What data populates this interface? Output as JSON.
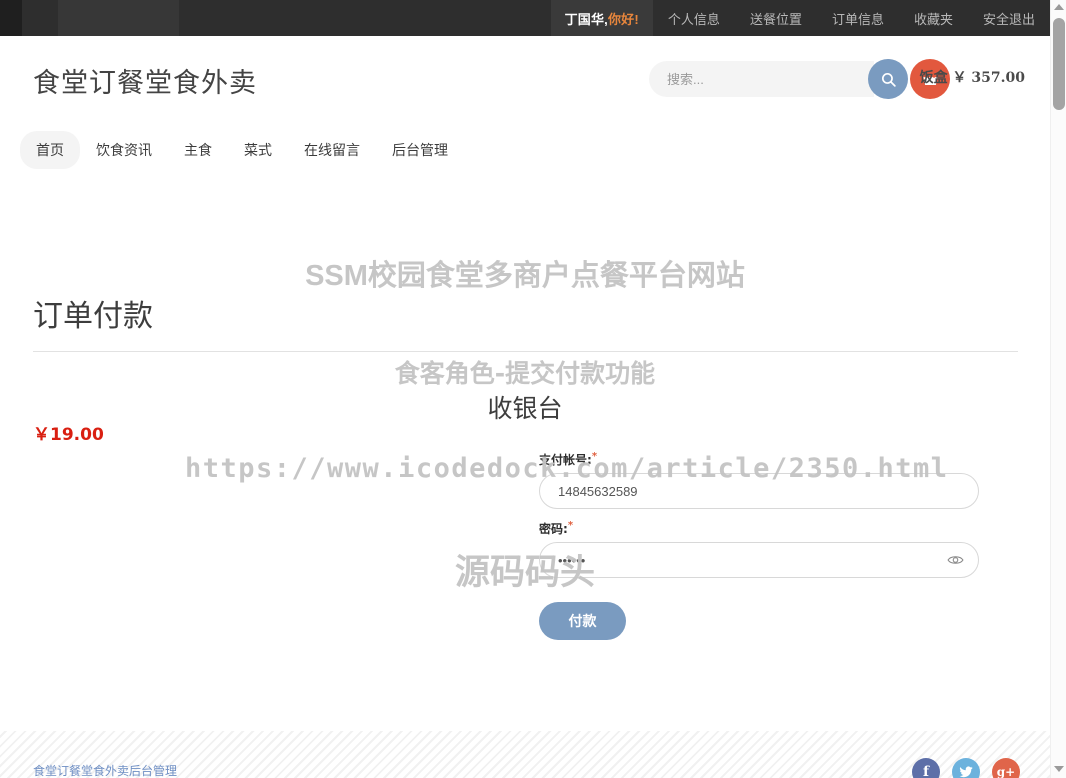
{
  "topbar": {
    "greeting_name": "丁国华,",
    "greeting_hi": "你好!",
    "links": [
      {
        "label": "个人信息"
      },
      {
        "label": "送餐位置"
      },
      {
        "label": "订单信息"
      },
      {
        "label": "收藏夹"
      },
      {
        "label": "安全退出"
      }
    ]
  },
  "header": {
    "logo": "食堂订餐堂食外卖",
    "search_placeholder": "搜索...",
    "search_value": "",
    "cart_label": "饭盒 ￥ 357.00"
  },
  "mainnav": {
    "items": [
      {
        "label": "首页",
        "active": true
      },
      {
        "label": "饮食资讯",
        "active": false
      },
      {
        "label": "主食",
        "active": false
      },
      {
        "label": "菜式",
        "active": false
      },
      {
        "label": "在线留言",
        "active": false
      },
      {
        "label": "后台管理",
        "active": false
      }
    ]
  },
  "main": {
    "page_title": "订单付款",
    "price": "￥19.00",
    "cashier_title": "收银台",
    "form": {
      "account_label": "支付帐号:",
      "account_value": "14845632589",
      "account_required": "*",
      "password_label": "密码:",
      "password_value": "••••••",
      "password_required": "*",
      "submit_label": "付款"
    }
  },
  "watermarks": {
    "title": "SSM校园食堂多商户点餐平台网站",
    "role": "食客角色-提交付款功能",
    "url": "https://www.icodedock.com/article/2350.html",
    "brand": "源码码头"
  },
  "footer": {
    "link": "食堂订餐堂食外卖后台管理",
    "social": [
      {
        "name": "facebook",
        "glyph": "f",
        "color": "#5d6fa8"
      },
      {
        "name": "twitter",
        "glyph": "🐦",
        "color": "#6cb2dd"
      },
      {
        "name": "googleplus",
        "glyph": "g+",
        "color": "#e0654a"
      }
    ]
  },
  "colors": {
    "accent_blue": "#7a9bc0",
    "accent_orange": "#e2583e",
    "price_red": "#d91f11",
    "topbar_dark": "#2e2e2e"
  }
}
